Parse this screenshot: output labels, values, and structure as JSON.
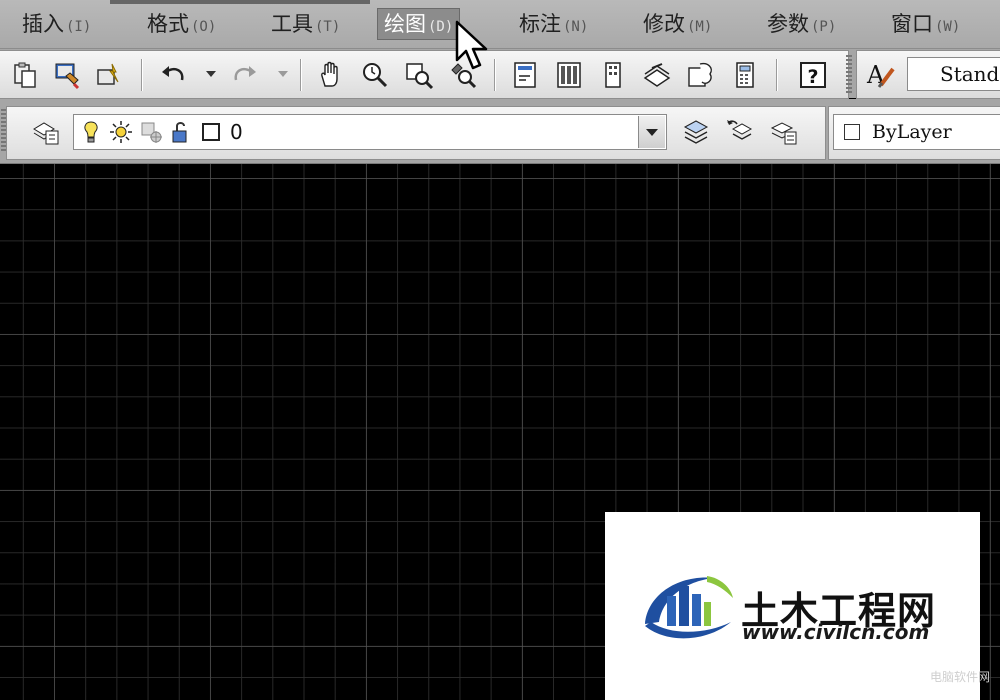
{
  "menubar": {
    "items": [
      {
        "label": "插入",
        "accel": "(I)"
      },
      {
        "label": "格式",
        "accel": "(O)"
      },
      {
        "label": "工具",
        "accel": "(T)"
      },
      {
        "label": "绘图",
        "accel": "(D)"
      },
      {
        "label": "标注",
        "accel": "(N)"
      },
      {
        "label": "修改",
        "accel": "(M)"
      },
      {
        "label": "参数",
        "accel": "(P)"
      },
      {
        "label": "窗口",
        "accel": "(W)"
      }
    ],
    "active_item": "绘图"
  },
  "standard_toolbar": {
    "icons": [
      "paste-icon",
      "match-properties-icon",
      "block-editor-icon",
      "undo-icon",
      "redo-icon",
      "pan-icon",
      "zoom-realtime-icon",
      "zoom-window-icon",
      "zoom-previous-icon",
      "properties-icon",
      "design-center-icon",
      "tool-palettes-icon",
      "sheet-set-icon",
      "markup-icon",
      "quickcalc-icon",
      "help-icon"
    ],
    "text_style_icon": "text-style-icon",
    "text_style_value": "Standard"
  },
  "layers_toolbar": {
    "layer_manager_icon": "layer-properties-icon",
    "current_layer": "0",
    "layer_state_icons": [
      "lightbulb-on-icon",
      "sun-thaw-icon",
      "viewport-freeze-icon",
      "lock-open-icon",
      "color-swatch-icon"
    ],
    "right_icons": [
      "make-current-icon",
      "layer-previous-icon",
      "layer-states-icon"
    ],
    "color_control": "ByLayer"
  },
  "watermark": {
    "name": "土木工程网",
    "url": "www.civilcn.com",
    "corner_text": "电脑软件网"
  },
  "colors": {
    "menubar": "#b0b0b0",
    "canvas": "#000000",
    "logo_blue": "#1f4fa0",
    "logo_green": "#8cc63f"
  }
}
